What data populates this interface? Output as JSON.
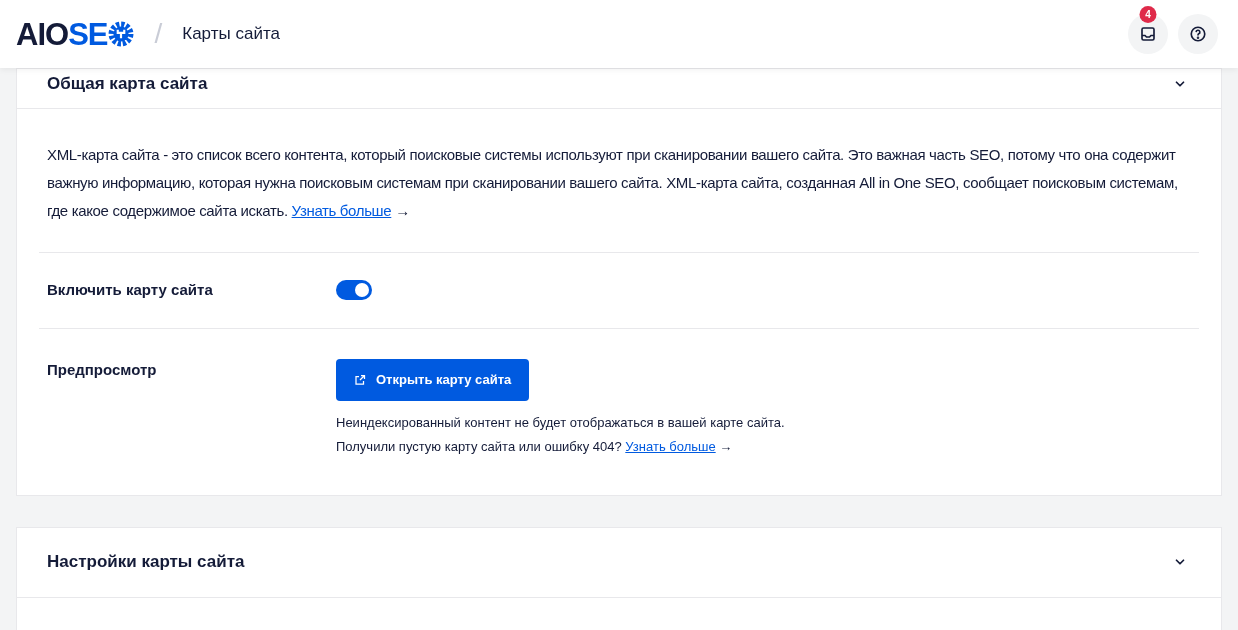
{
  "header": {
    "logo": {
      "dark": "AIO",
      "accent": "SE"
    },
    "separator": "/",
    "breadcrumb": "Карты сайта",
    "notifications_count": "4"
  },
  "cards": [
    {
      "title": "Общая карта сайта",
      "expanded": true,
      "description": {
        "text": "XML-карта сайта - это список всего контента, который поисковые системы используют при сканировании вашего сайта. Это важная часть SEO, потому что она содержит важную информацию, которая нужна поисковым системам при сканировании вашего сайта. XML-карта сайта, созданная All in One SEO, сообщает поисковым системам, где какое содержимое сайта искать.",
        "link": "Узнать больше",
        "arrow": "→"
      },
      "settings": [
        {
          "kind": "toggle",
          "label": "Включить карту сайта",
          "on": true
        },
        {
          "kind": "button",
          "label": "Предпросмотр",
          "button": "Открыть карту сайта",
          "notes": [
            "Неиндексированный контент не будет отображаться в вашей карте сайта."
          ],
          "help": {
            "text": "Получили пустую карту сайта или ошибку 404?",
            "link": "Узнать больше",
            "arrow": "→"
          }
        }
      ]
    },
    {
      "title": "Настройки карты сайта",
      "expanded": true
    }
  ]
}
